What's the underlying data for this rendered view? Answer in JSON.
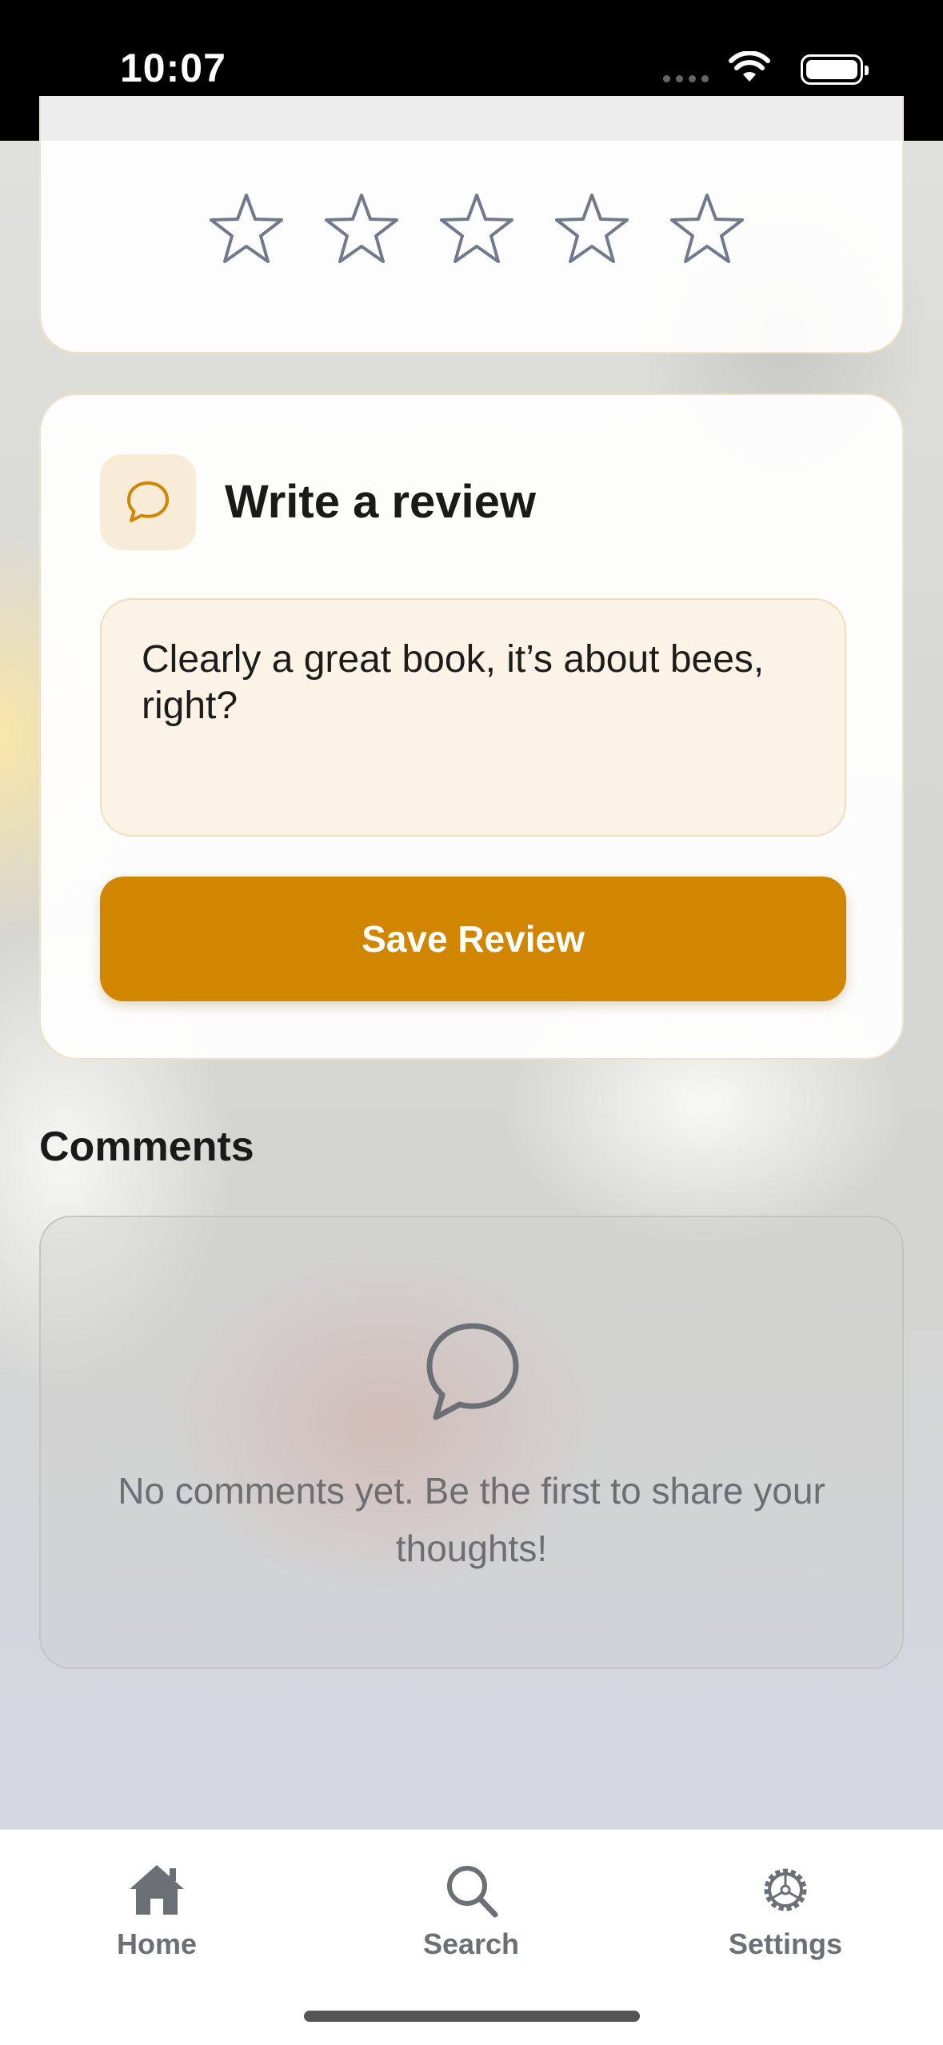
{
  "status_bar": {
    "time": "10:07"
  },
  "rating": {
    "star_count": 5,
    "selected": 0
  },
  "review": {
    "title": "Write a review",
    "text": "Clearly a great book, it’s about bees, right?",
    "save_label": "Save Review"
  },
  "comments": {
    "heading": "Comments",
    "empty_message": "No comments yet. Be the first to share your thoughts!"
  },
  "tab_bar": {
    "items": [
      {
        "label": "Home",
        "icon": "home-icon"
      },
      {
        "label": "Search",
        "icon": "search-icon"
      },
      {
        "label": "Settings",
        "icon": "gear-icon"
      }
    ]
  },
  "colors": {
    "accent": "#d08600",
    "star_outline": "#707a8c",
    "tab_inactive": "#6b6f76"
  }
}
